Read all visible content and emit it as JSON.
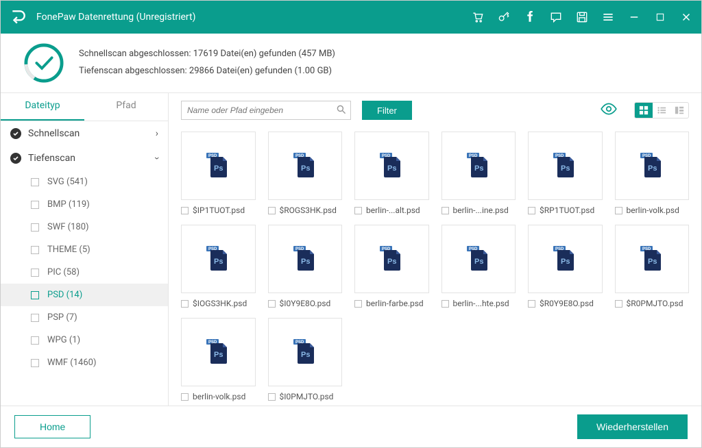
{
  "titlebar": {
    "title": "FonePaw Datenrettung (Unregistriert)"
  },
  "status": {
    "line1": "Schnellscan abgeschlossen: 17619 Datei(en) gefunden (457 MB)",
    "line2": "Tiefenscan abgeschlossen: 29866 Datei(en) gefunden (1.00 GB)"
  },
  "tabs": {
    "filetype": "Dateityp",
    "path": "Pfad"
  },
  "sidebar": {
    "quickscan": "Schnellscan",
    "deepscan": "Tiefenscan",
    "filetypes": [
      {
        "label": "SVG (541)",
        "active": false
      },
      {
        "label": "BMP (119)",
        "active": false
      },
      {
        "label": "SWF (180)",
        "active": false
      },
      {
        "label": "THEME (5)",
        "active": false
      },
      {
        "label": "PIC (58)",
        "active": false
      },
      {
        "label": "PSD (14)",
        "active": true
      },
      {
        "label": "PSP (7)",
        "active": false
      },
      {
        "label": "WPG (1)",
        "active": false
      },
      {
        "label": "WMF (1460)",
        "active": false
      }
    ]
  },
  "toolbar": {
    "search_placeholder": "Name oder Pfad eingeben",
    "filter": "Filter"
  },
  "files": [
    "$IP1TUOT.psd",
    "$ROGS3HK.psd",
    "berlin-...alt.psd",
    "berlin-...ine.psd",
    "$RP1TUOT.psd",
    "berlin-volk.psd",
    "$IOGS3HK.psd",
    "$I0Y9E8O.psd",
    "berlin-farbe.psd",
    "berlin-...hte.psd",
    "$R0Y9E8O.psd",
    "$R0PMJTO.psd",
    "berlin-volk.psd",
    "$I0PMJTO.psd"
  ],
  "footer": {
    "home": "Home",
    "recover": "Wiederherstellen"
  }
}
